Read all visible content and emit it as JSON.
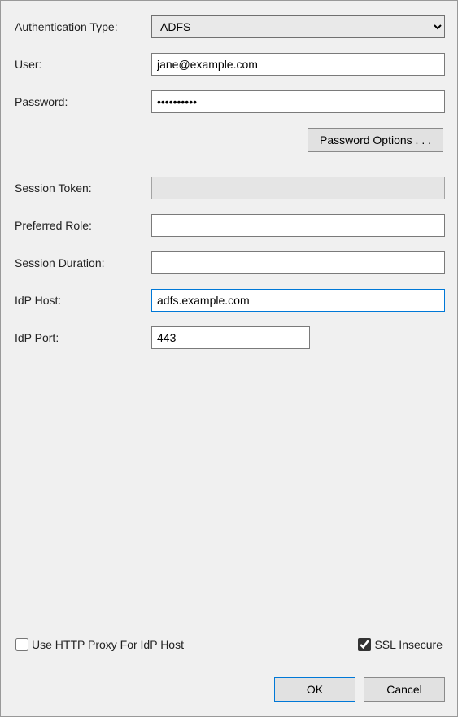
{
  "labels": {
    "auth_type": "Authentication Type:",
    "user": "User:",
    "password": "Password:",
    "password_options": "Password Options . . .",
    "session_token": "Session Token:",
    "preferred_role": "Preferred Role:",
    "session_duration": "Session Duration:",
    "idp_host": "IdP Host:",
    "idp_port": "IdP Port:",
    "use_http_proxy": "Use HTTP Proxy For IdP Host",
    "ssl_insecure": "SSL Insecure",
    "ok": "OK",
    "cancel": "Cancel"
  },
  "values": {
    "auth_type": "ADFS",
    "user": "jane@example.com",
    "password": "••••••••••",
    "session_token": "",
    "preferred_role": "",
    "session_duration": "",
    "idp_host": "adfs.example.com",
    "idp_port": "443",
    "use_http_proxy": false,
    "ssl_insecure": true
  },
  "options": {
    "auth_type": [
      "ADFS"
    ]
  }
}
